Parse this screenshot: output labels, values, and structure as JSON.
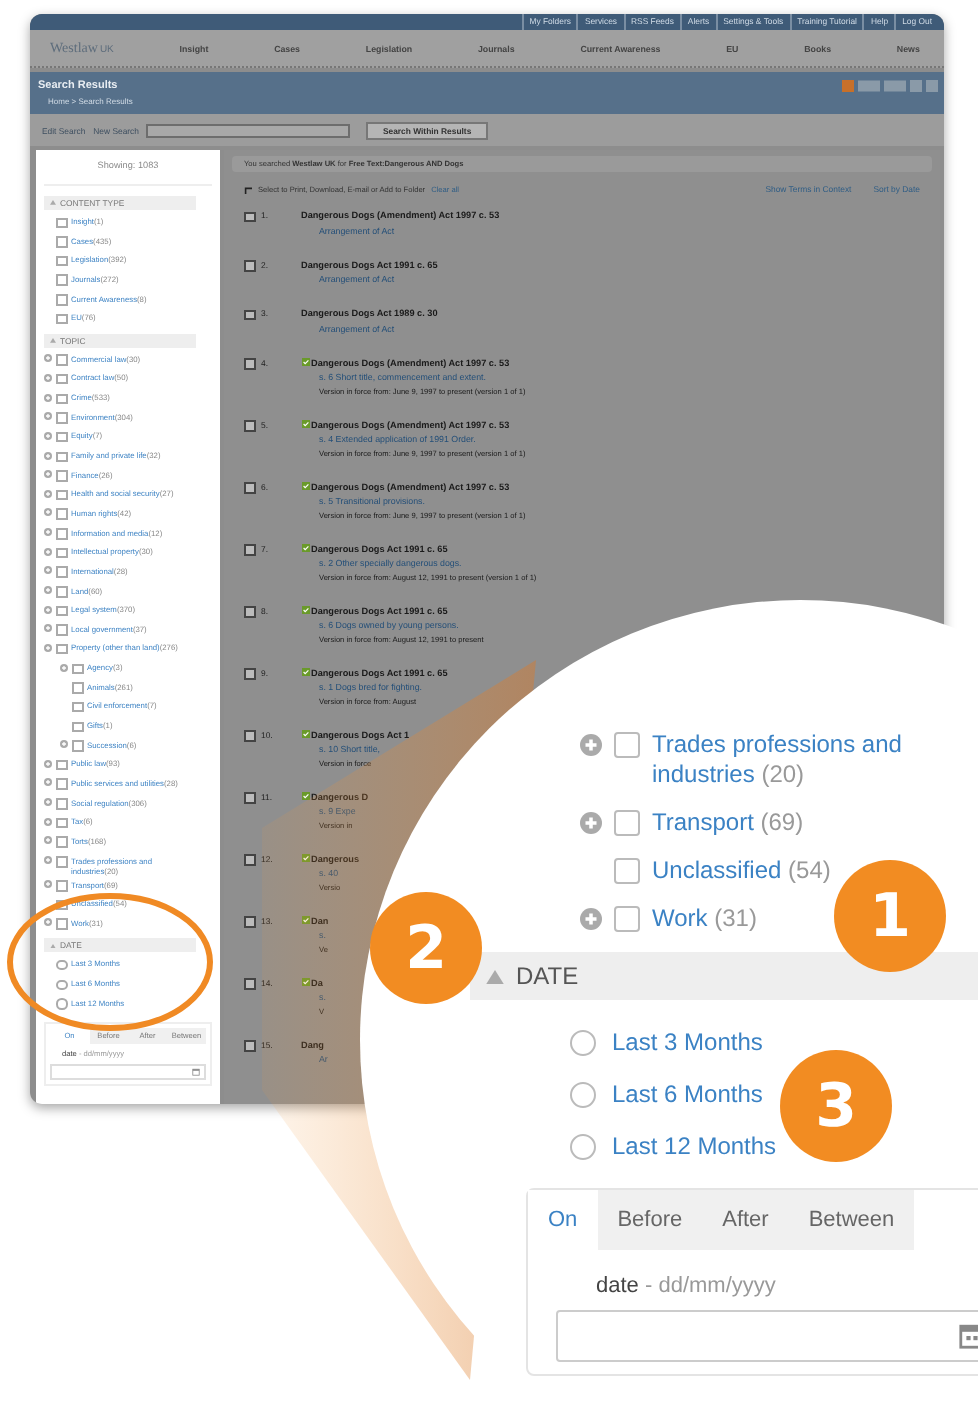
{
  "top_links": [
    "My Folders",
    "Services",
    "RSS Feeds",
    "Alerts",
    "Settings & Tools",
    "Training Tutorial",
    "Help",
    "Log Out"
  ],
  "logo": {
    "name": "Westlaw",
    "suffix": "UK"
  },
  "nav": [
    "Insight",
    "Cases",
    "Legislation",
    "Journals",
    "Current Awareness",
    "EU",
    "Books",
    "News"
  ],
  "page": {
    "title": "Search Results",
    "breadcrumb": "Home > Search Results"
  },
  "search": {
    "links": [
      "Edit Search",
      "New Search"
    ],
    "button": "Search Within Results"
  },
  "sidebar": {
    "showing": "Showing: 1083",
    "sections": [
      {
        "title": "CONTENT TYPE",
        "expanded": true,
        "kind": "checkbox",
        "items": [
          {
            "label": "Insight",
            "count": "(1)",
            "expandable": false,
            "checked": false
          },
          {
            "label": "Cases",
            "count": "(435)",
            "expandable": false,
            "checked": false
          },
          {
            "label": "Legislation",
            "count": "(392)",
            "expandable": false,
            "checked": false
          },
          {
            "label": "Journals",
            "count": "(272)",
            "expandable": false,
            "checked": false
          },
          {
            "label": "Current Awareness",
            "count": "(8)",
            "expandable": false,
            "checked": false
          },
          {
            "label": "EU",
            "count": "(76)",
            "expandable": false,
            "checked": false
          }
        ]
      },
      {
        "title": "TOPIC",
        "expanded": true,
        "kind": "checkbox",
        "items": [
          {
            "label": "Commercial law",
            "count": "(30)",
            "expandable": true,
            "checked": false
          },
          {
            "label": "Contract law",
            "count": "(50)",
            "expandable": true,
            "checked": false
          },
          {
            "label": "Crime",
            "count": "(533)",
            "expandable": true,
            "checked": false
          },
          {
            "label": "Environment",
            "count": "(304)",
            "expandable": true,
            "checked": false
          },
          {
            "label": "Equity",
            "count": "(7)",
            "expandable": true,
            "checked": false
          },
          {
            "label": "Family and private life",
            "count": "(32)",
            "expandable": true,
            "checked": false
          },
          {
            "label": "Finance",
            "count": "(26)",
            "expandable": true,
            "checked": false
          },
          {
            "label": "Health and social security",
            "count": "(27)",
            "expandable": true,
            "checked": false
          },
          {
            "label": "Human rights",
            "count": "(42)",
            "expandable": true,
            "checked": false
          },
          {
            "label": "Information and media",
            "count": "(12)",
            "expandable": true,
            "checked": false
          },
          {
            "label": "Intellectual property",
            "count": "(30)",
            "expandable": true,
            "checked": false
          },
          {
            "label": "International",
            "count": "(28)",
            "expandable": true,
            "checked": false
          },
          {
            "label": "Land",
            "count": "(60)",
            "expandable": true,
            "checked": false
          },
          {
            "label": "Legal system",
            "count": "(370)",
            "expandable": true,
            "checked": false
          },
          {
            "label": "Local government",
            "count": "(37)",
            "expandable": true,
            "checked": false
          },
          {
            "label": "Property (other than land)",
            "count": "(276)",
            "expandable": true,
            "checked": false,
            "children": [
              {
                "label": "Agency",
                "count": "(3)",
                "expandable": true,
                "checked": false
              },
              {
                "label": "Animals",
                "count": "(261)",
                "expandable": false,
                "checked": false
              },
              {
                "label": "Civil enforcement",
                "count": "(7)",
                "expandable": false,
                "checked": false
              },
              {
                "label": "Gifts",
                "count": "(1)",
                "expandable": false,
                "checked": false
              },
              {
                "label": "Succession",
                "count": "(6)",
                "expandable": true,
                "checked": false
              }
            ]
          },
          {
            "label": "Public law",
            "count": "(93)",
            "expandable": true,
            "checked": false
          },
          {
            "label": "Public services and utilities",
            "count": "(28)",
            "expandable": true,
            "checked": false
          },
          {
            "label": "Social regulation",
            "count": "(306)",
            "expandable": true,
            "checked": false
          },
          {
            "label": "Tax",
            "count": "(6)",
            "expandable": true,
            "checked": false
          },
          {
            "label": "Torts",
            "count": "(168)",
            "expandable": true,
            "checked": false
          },
          {
            "label": "Trades professions and industries",
            "count": "(20)",
            "expandable": true,
            "checked": false
          },
          {
            "label": "Transport",
            "count": "(69)",
            "expandable": true,
            "checked": false
          },
          {
            "label": "Unclassified",
            "count": "(54)",
            "expandable": false,
            "checked": false
          },
          {
            "label": "Work",
            "count": "(31)",
            "expandable": true,
            "checked": false
          }
        ]
      },
      {
        "title": "DATE",
        "expanded": true,
        "kind": "radio",
        "items": [
          {
            "label": "Last 3 Months",
            "selected": false
          },
          {
            "label": "Last 6 Months",
            "selected": false
          },
          {
            "label": "Last 12 Months",
            "selected": false
          }
        ]
      }
    ],
    "date_tabs": [
      {
        "label": "On",
        "selected": true
      },
      {
        "label": "Before",
        "selected": false
      },
      {
        "label": "After",
        "selected": false
      },
      {
        "label": "Between",
        "selected": false
      }
    ],
    "field_label": "date",
    "format_hint": "- dd/mm/yyyy"
  },
  "results": {
    "summary": "You searched **Westlaw UK** for **Free Text:Dangerous AND Dogs**",
    "select_hint": "Select to Print, Download, E-mail or Add to Folder",
    "clear": "Clear all",
    "links": [
      "Show Terms in Context",
      "Sort by Date"
    ],
    "rows": [
      {
        "number": "1.",
        "checked": false,
        "in_force": false,
        "title": "Dangerous Dogs (Amendment) Act 1997 c. 53",
        "subtitle": "Arrangement of Act"
      },
      {
        "number": "2.",
        "checked": false,
        "in_force": false,
        "title": "Dangerous Dogs Act 1991 c. 65",
        "subtitle": "Arrangement of Act"
      },
      {
        "number": "3.",
        "checked": false,
        "in_force": false,
        "title": "Dangerous Dogs Act 1989 c. 30",
        "subtitle": "Arrangement of Act"
      },
      {
        "number": "4.",
        "checked": false,
        "in_force": true,
        "title": "Dangerous Dogs (Amendment) Act 1997 c. 53",
        "subtitle": "s. 6 Short title, commencement and extent.",
        "version": "Version in force from: June 9, 1997 to present (version 1 of 1)"
      },
      {
        "number": "5.",
        "checked": false,
        "in_force": true,
        "title": "Dangerous Dogs (Amendment) Act 1997 c. 53",
        "subtitle": "s. 4 Extended application of 1991 Order.",
        "version": "Version in force from: June 9, 1997 to present (version 1 of 1)"
      },
      {
        "number": "6.",
        "checked": false,
        "in_force": true,
        "title": "Dangerous Dogs (Amendment) Act 1997 c. 53",
        "subtitle": "s. 5 Transitional provisions.",
        "version": "Version in force from: June 9, 1997 to present (version 1 of 1)"
      },
      {
        "number": "7.",
        "checked": false,
        "in_force": true,
        "title": "Dangerous Dogs Act 1991 c. 65",
        "subtitle": "s. 2 Other specially dangerous dogs.",
        "version": "Version in force from: August 12, 1991 to present (version 1 of 1)"
      },
      {
        "number": "8.",
        "checked": false,
        "in_force": true,
        "title": "Dangerous Dogs Act 1991 c. 65",
        "subtitle": "s. 6 Dogs owned by young persons.",
        "version": "Version in force from: August 12, 1991 to present"
      },
      {
        "number": "9.",
        "checked": false,
        "in_force": true,
        "title": "Dangerous Dogs Act 1991 c. 65",
        "subtitle": "s. 1 Dogs bred for fighting.",
        "version": "Version in force from: August"
      },
      {
        "number": "10.",
        "checked": false,
        "in_force": true,
        "title": "Dangerous Dogs Act 1",
        "subtitle": "s. 10 Short title,",
        "version": "Version in force"
      },
      {
        "number": "11.",
        "checked": false,
        "in_force": true,
        "title": "Dangerous D",
        "subtitle": "s. 9 Expe",
        "version": "Version in"
      },
      {
        "number": "12.",
        "checked": false,
        "in_force": true,
        "title": "Dangerous",
        "subtitle": "s. 40",
        "version": "Versio"
      },
      {
        "number": "13.",
        "checked": false,
        "in_force": true,
        "title": "Dan",
        "subtitle": "s.",
        "version": "Ve"
      },
      {
        "number": "14.",
        "checked": false,
        "in_force": true,
        "title": "Da",
        "subtitle": "s.",
        "version": "V"
      },
      {
        "number": "15.",
        "checked": false,
        "in_force": false,
        "title": "Dang",
        "subtitle": "Ar"
      }
    ]
  },
  "magnifier": {
    "items": [
      {
        "label": "Trades professions and industries",
        "count": "(20)",
        "expandable": true,
        "checked": false
      },
      {
        "label": "Transport",
        "count": "(69)",
        "expandable": true,
        "checked": false
      },
      {
        "label": "Unclassified",
        "count": "(54)",
        "expandable": false,
        "checked": false
      },
      {
        "label": "Work",
        "count": "(31)",
        "expandable": true,
        "checked": false
      }
    ],
    "date_header": "DATE",
    "date_expanded": true,
    "radios": [
      {
        "label": "Last 3 Months",
        "selected": false
      },
      {
        "label": "Last 6 Months",
        "selected": false
      },
      {
        "label": "Last 12 Months",
        "selected": false
      }
    ],
    "tabs": [
      {
        "label": "On",
        "selected": true
      },
      {
        "label": "Before",
        "selected": false
      },
      {
        "label": "After",
        "selected": false
      },
      {
        "label": "Between",
        "selected": false
      }
    ],
    "field_label": "date",
    "format_hint": "- dd/mm/yyyy"
  },
  "callouts": [
    "1",
    "2",
    "3"
  ]
}
